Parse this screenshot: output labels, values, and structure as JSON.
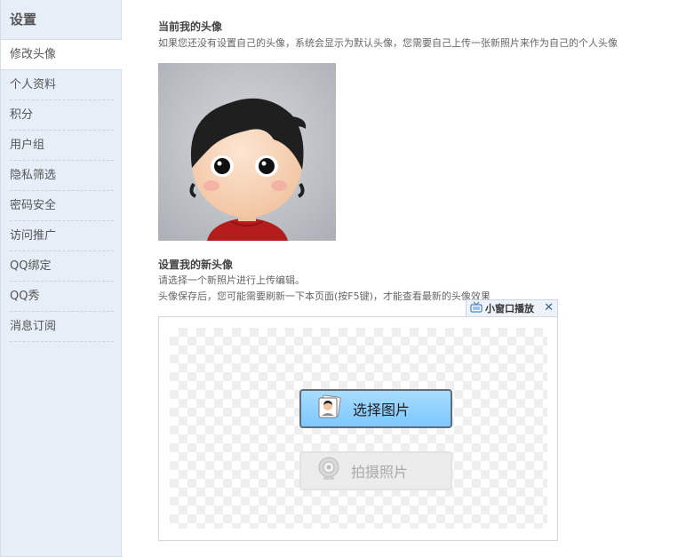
{
  "sidebar": {
    "title": "设置",
    "items": [
      {
        "label": "修改头像",
        "active": true
      },
      {
        "label": "个人资料"
      },
      {
        "label": "积分"
      },
      {
        "label": "用户组"
      },
      {
        "label": "隐私筛选"
      },
      {
        "label": "密码安全"
      },
      {
        "label": "访问推广"
      },
      {
        "label": "QQ绑定"
      },
      {
        "label": "QQ秀"
      },
      {
        "label": "消息订阅"
      }
    ]
  },
  "current": {
    "title": "当前我的头像",
    "desc": "如果您还没有设置自己的头像，系统会显示为默认头像，您需要自己上传一张新照片来作为自己的个人头像"
  },
  "new_avatar": {
    "title": "设置我的新头像",
    "line1": "请选择一个新照片进行上传编辑。",
    "line2": "头像保存后，您可能需要刷新一下本页面(按F5键)，才能查看最新的头像效果"
  },
  "mini_window": {
    "label": "小窗口播放",
    "close": "✕"
  },
  "upload": {
    "select_label": "选择图片",
    "camera_label": "拍摄照片"
  },
  "colors": {
    "sidebar_bg": "#e6eef7",
    "select_button": "#7cc8ff",
    "camera_button": "#ececec"
  }
}
